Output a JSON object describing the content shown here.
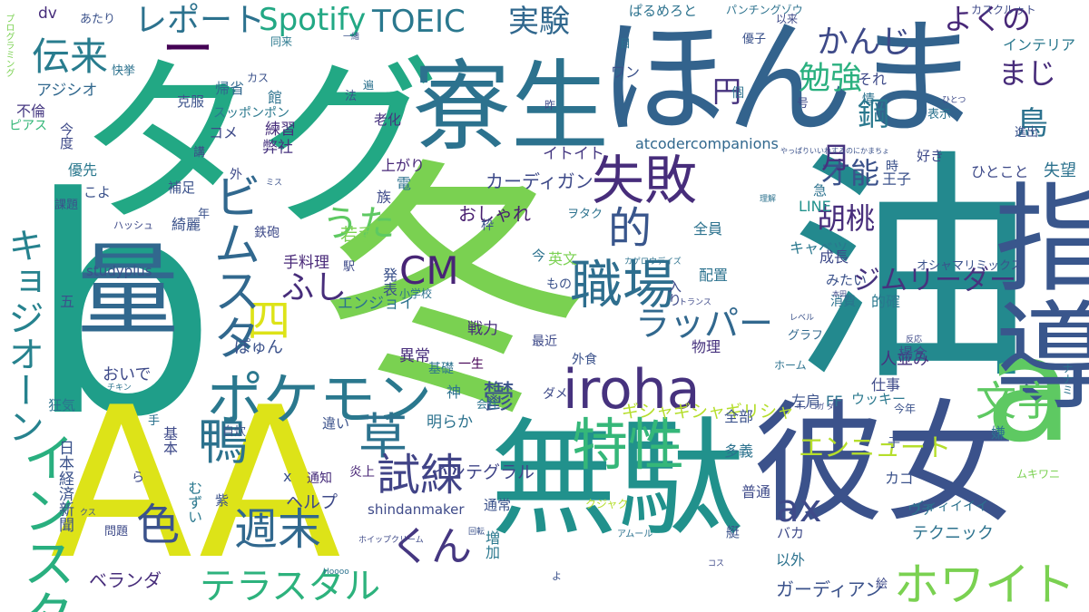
{
  "words": [
    {
      "id": "b",
      "text": "b",
      "color": "#1f9e89"
    },
    {
      "id": "fuyu",
      "text": "冬",
      "color": "#7ad151"
    },
    {
      "id": "aa",
      "text": "AA",
      "color": "#dde318"
    },
    {
      "id": "yu",
      "text": "油",
      "color": "#23898e"
    },
    {
      "id": "tagu",
      "text": "タグ",
      "color": "#22a884"
    },
    {
      "id": "honma",
      "text": "ほんま",
      "color": "#33638d"
    },
    {
      "id": "dash",
      "text": "ー",
      "color": "#440154"
    },
    {
      "id": "muda",
      "text": "無駄",
      "color": "#21918c"
    },
    {
      "id": "kanojo",
      "text": "彼女",
      "color": "#3b528b"
    },
    {
      "id": "ryosei",
      "text": "寮生",
      "color": "#2c728e"
    },
    {
      "id": "ryo",
      "text": "量",
      "color": "#31688e"
    },
    {
      "id": "a",
      "text": "a",
      "color": "#5ec962"
    },
    {
      "id": "shido",
      "text": "指導",
      "color": "#39568c"
    },
    {
      "id": "iroha",
      "text": "iroha",
      "color": "#46327e"
    },
    {
      "id": "pokemon",
      "text": "ポケモン",
      "color": "#2a788e"
    },
    {
      "id": "tokusei",
      "text": "特性",
      "color": "#35b779"
    },
    {
      "id": "shokuba",
      "text": "職場",
      "color": "#2e6e8e"
    },
    {
      "id": "shippai",
      "text": "失敗",
      "color": "#472d7b"
    },
    {
      "id": "kusa",
      "text": "草",
      "color": "#2c728e"
    },
    {
      "id": "kamo",
      "text": "鴨",
      "color": "#2c728e"
    },
    {
      "id": "white",
      "text": "ホワイト",
      "color": "#7ad151"
    },
    {
      "id": "moji",
      "text": "文字",
      "color": "#5ec962"
    },
    {
      "id": "shiren",
      "text": "試練",
      "color": "#414487"
    },
    {
      "id": "iro",
      "text": "色",
      "color": "#3b528b"
    },
    {
      "id": "shumatsu",
      "text": "週末",
      "color": "#31688e"
    },
    {
      "id": "kun",
      "text": "くん",
      "color": "#453781"
    },
    {
      "id": "terastal",
      "text": "テラスタル",
      "color": "#2db27d"
    },
    {
      "id": "ax",
      "text": "ax",
      "color": "#3e4a89"
    },
    {
      "id": "cm",
      "text": "CM",
      "color": "#482576"
    },
    {
      "id": "rapper",
      "text": "ラッパー",
      "color": "#31688e"
    },
    {
      "id": "teki",
      "text": "的",
      "color": "#39568c"
    },
    {
      "id": "yon",
      "text": "四",
      "color": "#dde318"
    },
    {
      "id": "fushi",
      "text": "ふし",
      "color": "#472d7b"
    },
    {
      "id": "uta",
      "text": "うた",
      "color": "#5ec962"
    },
    {
      "id": "gymleader",
      "text": "ジムリーダー",
      "color": "#46327e"
    },
    {
      "id": "bimusuta",
      "text": "ビムスタ",
      "color": "#31688e"
    },
    {
      "id": "insta",
      "text": "インスタ",
      "color": "#29af7f"
    },
    {
      "id": "kyojio",
      "text": "キョジオーン",
      "color": "#26828e"
    },
    {
      "id": "report",
      "text": "レポート",
      "color": "#2c728e"
    },
    {
      "id": "spotify",
      "text": "Spotify",
      "color": "#22a884"
    },
    {
      "id": "toeic",
      "text": "TOEIC",
      "color": "#2a788e"
    },
    {
      "id": "jikken",
      "text": "実験",
      "color": "#31688e"
    },
    {
      "id": "denrai",
      "text": "伝来",
      "color": "#287c8e"
    },
    {
      "id": "kanji",
      "text": "かんじ",
      "color": "#3e4a89"
    },
    {
      "id": "yokuno",
      "text": "よくの",
      "color": "#482878"
    },
    {
      "id": "benkyo",
      "text": "勉強",
      "color": "#2ab07f"
    },
    {
      "id": "maji",
      "text": "まじ",
      "color": "#472c7a"
    },
    {
      "id": "en",
      "text": "円",
      "color": "#46327e"
    },
    {
      "id": "kou",
      "text": "鋼",
      "color": "#2a788e"
    },
    {
      "id": "tori",
      "text": "鳥",
      "color": "#2c728e"
    },
    {
      "id": "sainou",
      "text": "才能",
      "color": "#3b528b"
    },
    {
      "id": "kurumi",
      "text": "胡桃",
      "color": "#472d7b"
    },
    {
      "id": "tsuki",
      "text": "月",
      "color": "#46327e"
    },
    {
      "id": "utsu",
      "text": "鬱",
      "color": "#3b528b"
    },
    {
      "id": "ennyute",
      "text": "エンニュート",
      "color": "#b5de2b"
    },
    {
      "id": "integral",
      "text": "インテグラル",
      "color": "#404588"
    },
    {
      "id": "atcoder",
      "text": "atcodercompanions",
      "color": "#31688e"
    },
    {
      "id": "cardigan",
      "text": "カーディガン",
      "color": "#3e4a89"
    },
    {
      "id": "ittoito",
      "text": "イトイト",
      "color": "#453882"
    },
    {
      "id": "gishagisha",
      "text": "ギシャギシャギリシャ",
      "color": "#b5de2b"
    },
    {
      "id": "oshare",
      "text": "おしゃれ",
      "color": "#481f70"
    },
    {
      "id": "enjoy",
      "text": "エンジョイ",
      "color": "#2c728e"
    },
    {
      "id": "wakate",
      "text": "若手",
      "color": "#7ad151"
    },
    {
      "id": "studyplus",
      "text": "studyplus",
      "color": "#3b528b"
    },
    {
      "id": "shindan",
      "text": "shindanmaker",
      "color": "#3e4a89"
    },
    {
      "id": "nikkei",
      "text": "日本経済新聞",
      "color": "#3b528b"
    },
    {
      "id": "teryori",
      "text": "手料理",
      "color": "#482878"
    },
    {
      "id": "pyun",
      "text": "ぽゅん",
      "color": "#3b528b"
    },
    {
      "id": "oide",
      "text": "おいで",
      "color": "#3e4a89"
    },
    {
      "id": "gardian",
      "text": "ガーディアン",
      "color": "#3b528b"
    },
    {
      "id": "technic",
      "text": "テクニック",
      "color": "#2c728e"
    },
    {
      "id": "veranda",
      "text": "ベランダ",
      "color": "#472d7b"
    },
    {
      "id": "help",
      "text": "ヘルプ",
      "color": "#3e4a89"
    },
    {
      "id": "osharemix",
      "text": "オシャマリミックス",
      "color": "#3b528b"
    },
    {
      "id": "cabbage",
      "text": "キャベツ",
      "color": "#2a788e"
    },
    {
      "id": "jinnami",
      "text": "人並み",
      "color": "#46327e"
    },
    {
      "id": "shigoto",
      "text": "仕事",
      "color": "#3e4a89"
    },
    {
      "id": "graph",
      "text": "グラフ",
      "color": "#31688e"
    },
    {
      "id": "home",
      "text": "ホーム",
      "color": "#2c728e"
    },
    {
      "id": "seicho",
      "text": "成長",
      "color": "#3e4a89"
    },
    {
      "id": "mitai",
      "text": "みたい",
      "color": "#3b528b"
    },
    {
      "id": "shohi",
      "text": "消費",
      "color": "#2c728e"
    },
    {
      "id": "tekikaku",
      "text": "的確",
      "color": "#2a788e"
    },
    {
      "id": "baai",
      "text": "場合",
      "color": "#3b528b"
    },
    {
      "id": "kisoku",
      "text": "基礎",
      "color": "#2c728e"
    },
    {
      "id": "issei",
      "text": "一生",
      "color": "#440154"
    },
    {
      "id": "ijo",
      "text": "異常",
      "color": "#472d7b"
    },
    {
      "id": "hitokoto",
      "text": "ひとこと",
      "color": "#3e4a89"
    },
    {
      "id": "shitsubo",
      "text": "失望",
      "color": "#2c728e"
    },
    {
      "id": "line",
      "text": "LINE",
      "color": "#21918c"
    },
    {
      "id": "ouji",
      "text": "王子",
      "color": "#3b528b"
    },
    {
      "id": "interior",
      "text": "インテリア",
      "color": "#2a788e"
    },
    {
      "id": "kaskrut",
      "text": "カスクルゥト",
      "color": "#3e4a89"
    },
    {
      "id": "punching",
      "text": "パンチングゾウ",
      "color": "#2c728e"
    },
    {
      "id": "parumeroto",
      "text": "ぱるめろと",
      "color": "#2c728e"
    },
    {
      "id": "dv",
      "text": "dv",
      "color": "#472d7b"
    },
    {
      "id": "ajishio",
      "text": "アジシオ",
      "color": "#31688e"
    },
    {
      "id": "furin",
      "text": "不倫",
      "color": "#453781"
    },
    {
      "id": "piasu",
      "text": "ピアス",
      "color": "#35b779"
    },
    {
      "id": "ulongnon",
      "text": "スッポンポン",
      "color": "#2a788e"
    },
    {
      "id": "kifuku",
      "text": "克服",
      "color": "#3b528b"
    },
    {
      "id": "rensyu",
      "text": "練習",
      "color": "#472d7b"
    },
    {
      "id": "heisha",
      "text": "弊社",
      "color": "#46327e"
    },
    {
      "id": "agari",
      "text": "上がり",
      "color": "#482878"
    },
    {
      "id": "yusen",
      "text": "優先",
      "color": "#2a788e"
    },
    {
      "id": "hosoku",
      "text": "補足",
      "color": "#3b528b"
    },
    {
      "id": "kirei",
      "text": "綺麗",
      "color": "#3b528b"
    },
    {
      "id": "kyoki",
      "text": "狂気",
      "color": "#2c728e"
    },
    {
      "id": "kihon",
      "text": "基本",
      "color": "#3e4a89"
    },
    {
      "id": "muzui",
      "text": "むずい",
      "color": "#2a788e"
    },
    {
      "id": "tsuchi",
      "text": "通知",
      "color": "#472d7b"
    },
    {
      "id": "enjo",
      "text": "炎上",
      "color": "#482576"
    },
    {
      "id": "akiraka",
      "text": "明らか",
      "color": "#2c728e"
    },
    {
      "id": "chigai",
      "text": "違い",
      "color": "#3b528b"
    },
    {
      "id": "senryoku",
      "text": "戦力",
      "color": "#472d7b"
    },
    {
      "id": "saikin",
      "text": "最近",
      "color": "#3e4a89"
    },
    {
      "id": "gaishoku",
      "text": "外食",
      "color": "#3b528b"
    },
    {
      "id": "zenin",
      "text": "全員",
      "color": "#2c728e"
    },
    {
      "id": "haichi",
      "text": "配置",
      "color": "#2c728e"
    },
    {
      "id": "butsuri",
      "text": "物理",
      "color": "#46327e"
    },
    {
      "id": "zenbu",
      "text": "全部",
      "color": "#3b528b"
    },
    {
      "id": "tagi",
      "text": "多義",
      "color": "#2c728e"
    },
    {
      "id": "futsu",
      "text": "普通",
      "color": "#3e4a89"
    },
    {
      "id": "tsujo",
      "text": "通常",
      "color": "#3b528b"
    },
    {
      "id": "zoka",
      "text": "増加",
      "color": "#2a788e"
    },
    {
      "id": "izen",
      "text": "以外",
      "color": "#2c728e"
    },
    {
      "id": "baka",
      "text": "バカ",
      "color": "#3e4a89"
    },
    {
      "id": "hidari",
      "text": "左肩",
      "color": "#3b528b"
    },
    {
      "id": "ff",
      "text": "FF",
      "color": "#2c728e"
    },
    {
      "id": "ukki",
      "text": "ウッキー",
      "color": "#2a788e"
    },
    {
      "id": "kotoshi",
      "text": "今年",
      "color": "#3b528b"
    },
    {
      "id": "iiii",
      "text": "イィィイイイ",
      "color": "#2c728e"
    },
    {
      "id": "muki",
      "text": "ムキワニ",
      "color": "#7ad151"
    },
    {
      "id": "kujaku",
      "text": "クジャク",
      "color": "#b5de2b"
    },
    {
      "id": "kago",
      "text": "カゴ",
      "color": "#3b528b"
    },
    {
      "id": "uchi",
      "text": "ウチ",
      "color": "#2c728e"
    },
    {
      "id": "mondai",
      "text": "問題",
      "color": "#3e4a89"
    },
    {
      "id": "gaku",
      "text": "英文",
      "color": "#7ad151"
    },
    {
      "id": "shogakko",
      "text": "小学校",
      "color": "#2c728e"
    },
    {
      "id": "mono",
      "text": "もの",
      "color": "#3b528b"
    },
    {
      "id": "happyo",
      "text": "発表",
      "color": "#3b528b"
    },
    {
      "id": "kobe",
      "text": "鉄砲",
      "color": "#3e4a89"
    },
    {
      "id": "x",
      "text": "x",
      "color": "#3b528b"
    },
    {
      "id": "jisui",
      "text": "自炊",
      "color": "#3b528b"
    },
    {
      "id": "shin",
      "text": "神",
      "color": "#2c728e"
    },
    {
      "id": "dame",
      "text": "ダメ",
      "color": "#3e4a89"
    },
    {
      "id": "kaisha",
      "text": "会社",
      "color": "#2c728e"
    },
    {
      "id": "kisho",
      "text": "帰省",
      "color": "#31688e"
    },
    {
      "id": "kome",
      "text": "コメ",
      "color": "#3e4a89"
    },
    {
      "id": "rouka",
      "text": "老化",
      "color": "#46327e"
    },
    {
      "id": "koyo",
      "text": "こよ",
      "color": "#3b528b"
    },
    {
      "id": "kondo",
      "text": "今度",
      "color": "#3e4a89"
    },
    {
      "id": "kadai",
      "text": "課題",
      "color": "#3b528b"
    },
    {
      "id": "hash",
      "text": "ハッシュ",
      "color": "#3e4a89"
    },
    {
      "id": "kaikyo",
      "text": "快挙",
      "color": "#2c728e"
    },
    {
      "id": "hitomi",
      "text": "同来",
      "color": "#2a788e"
    },
    {
      "id": "kasu",
      "text": "カス",
      "color": "#3b528b"
    },
    {
      "id": "wan",
      "text": "ワン",
      "color": "#3b528b"
    },
    {
      "id": "kore",
      "text": "それ",
      "color": "#3e4a89"
    },
    {
      "id": "kotoba",
      "text": "個",
      "color": "#2c728e"
    },
    {
      "id": "yuko",
      "text": "優子",
      "color": "#3b528b"
    },
    {
      "id": "jonetsu",
      "text": "情",
      "color": "#2c728e"
    },
    {
      "id": "go",
      "text": "号",
      "color": "#3e4a89"
    },
    {
      "id": "hyoji",
      "text": "表示",
      "color": "#2c728e"
    },
    {
      "id": "shinshutsu",
      "text": "進出",
      "color": "#3b528b"
    },
    {
      "id": "suki",
      "text": "好き",
      "color": "#3e4a89"
    },
    {
      "id": "toki",
      "text": "時",
      "color": "#3b528b"
    },
    {
      "id": "kyu",
      "text": "急",
      "color": "#2c728e"
    },
    {
      "id": "zoku",
      "text": "族",
      "color": "#3e4a89"
    },
    {
      "id": "ima",
      "text": "今",
      "color": "#2c728e"
    },
    {
      "id": "waku",
      "text": "枠",
      "color": "#3b528b"
    },
    {
      "id": "mokuteki",
      "text": "目",
      "color": "#2c728e"
    },
    {
      "id": "irai",
      "text": "以来",
      "color": "#3e4a89"
    },
    {
      "id": "atari",
      "text": "あたり",
      "color": "#3b528b"
    },
    {
      "id": "programming",
      "text": "プログラミング",
      "color": "#7ad151"
    },
    {
      "id": "kan",
      "text": "館",
      "color": "#2c728e"
    },
    {
      "id": "ko",
      "text": "講",
      "color": "#3e4a89"
    },
    {
      "id": "go5",
      "text": "五",
      "color": "#3b528b"
    },
    {
      "id": "te",
      "text": "手",
      "color": "#2c728e"
    },
    {
      "id": "ra",
      "text": "ら",
      "color": "#3e4a89"
    },
    {
      "id": "murasaki",
      "text": "紫",
      "color": "#3b528b"
    },
    {
      "id": "gai",
      "text": "外",
      "color": "#3e4a89"
    },
    {
      "id": "den",
      "text": "電",
      "color": "#2c728e"
    },
    {
      "id": "nen",
      "text": "年",
      "color": "#3b528b"
    },
    {
      "id": "eki",
      "text": "駅",
      "color": "#3e4a89"
    },
    {
      "id": "houbou",
      "text": "法",
      "color": "#3b528b"
    },
    {
      "id": "hen",
      "text": "遍",
      "color": "#2c728e"
    },
    {
      "id": "kinou",
      "text": "昨",
      "color": "#3e4a89"
    },
    {
      "id": "wotaku",
      "text": "ヲタク",
      "color": "#2c728e"
    },
    {
      "id": "ko2",
      "text": "子",
      "color": "#3b528b"
    },
    {
      "id": "e",
      "text": "絵",
      "color": "#3e4a89"
    },
    {
      "id": "ken",
      "text": "嫌",
      "color": "#2c728e"
    },
    {
      "id": "tei",
      "text": "艇",
      "color": "#3b528b"
    },
    {
      "id": "iretai",
      "text": "入り",
      "color": "#3e4a89"
    },
    {
      "id": "ichiyoku",
      "text": "一緒",
      "color": "#3b528b"
    },
    {
      "id": "trans",
      "text": "トランス",
      "color": "#3e4a89"
    },
    {
      "id": "chikin",
      "text": "チキン",
      "color": "#2c728e"
    },
    {
      "id": "level",
      "text": "レベル",
      "color": "#3b528b"
    },
    {
      "id": "hoffan",
      "text": "反応",
      "color": "#3e4a89"
    },
    {
      "id": "nanami",
      "text": "ナナミ",
      "color": "#2c728e"
    },
    {
      "id": "kuso",
      "text": "クス",
      "color": "#3b528b"
    },
    {
      "id": "kosu",
      "text": "コス",
      "color": "#3e4a89"
    },
    {
      "id": "hoooo",
      "text": "Hoooo",
      "color": "#2c728e"
    },
    {
      "id": "kaiten",
      "text": "回転",
      "color": "#3b528b"
    },
    {
      "id": "whipping",
      "text": "ホイップクリーム",
      "color": "#3e4a89"
    },
    {
      "id": "amuru",
      "text": "アムール",
      "color": "#2c728e"
    },
    {
      "id": "yuu",
      "text": "よ",
      "color": "#3b528b"
    },
    {
      "id": "honda",
      "text": "本田",
      "color": "#3e4a89"
    },
    {
      "id": "rikai",
      "text": "理解",
      "color": "#2c728e"
    },
    {
      "id": "mise",
      "text": "ミス",
      "color": "#3b528b"
    },
    {
      "id": "kinokoshi",
      "text": "キノコガ ダ",
      "color": "#3e4a89"
    },
    {
      "id": "kageyoko",
      "text": "カゲロウデイズ",
      "color": "#2c728e"
    },
    {
      "id": "yappari",
      "text": "やっぱりいいねするのにかまちょ",
      "color": "#3b528b"
    },
    {
      "id": "kameko",
      "text": "ひとつ",
      "color": "#3e4a89"
    }
  ]
}
